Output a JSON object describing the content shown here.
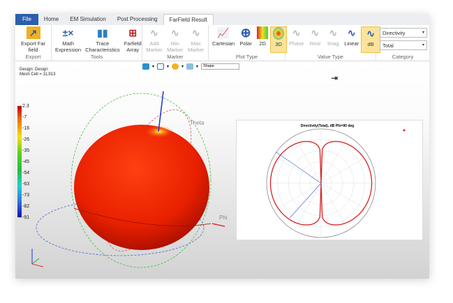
{
  "tabs": [
    "File",
    "Home",
    "EM Simulation",
    "Post Processing",
    "FarField Result"
  ],
  "ribbon": {
    "export": {
      "label": "Export",
      "buttons": [
        "Export Far field"
      ]
    },
    "tools": {
      "label": "Tools",
      "buttons": [
        "Math Expression",
        "Trace Characteristics",
        "Farfield Array"
      ]
    },
    "marker": {
      "label": "Marker",
      "buttons": [
        "Add Marker",
        "Min Marker",
        "Max Marker"
      ]
    },
    "plot_type": {
      "label": "Plot Type",
      "buttons": [
        "Cartesian",
        "Polar",
        "2D",
        "3D"
      ],
      "selected": "3D"
    },
    "value_type": {
      "label": "Value Type",
      "buttons": [
        "Phase",
        "Real",
        "Imag",
        "Linear",
        "dB"
      ],
      "selected": "dB"
    },
    "category": {
      "label": "Category",
      "quantity": "Directivity",
      "component": "Total"
    }
  },
  "view": {
    "design": "Design: Design",
    "mesh": "Mesh Cell = 11,913",
    "shape_select": "Shape",
    "axis_theta": "Theta",
    "axis_phi": "Phi"
  },
  "colorbar": {
    "labels": [
      "2.3",
      "-7",
      "-16",
      "-26",
      "-35",
      "-45",
      "-54",
      "-63",
      "-73",
      "-82",
      "-91"
    ]
  },
  "chart_data": {
    "type": "polar",
    "title": "Directivity(Total), dB Phi=90 deg",
    "colors": {
      "trace": "#d62020",
      "cursor": "#4060d0"
    }
  }
}
